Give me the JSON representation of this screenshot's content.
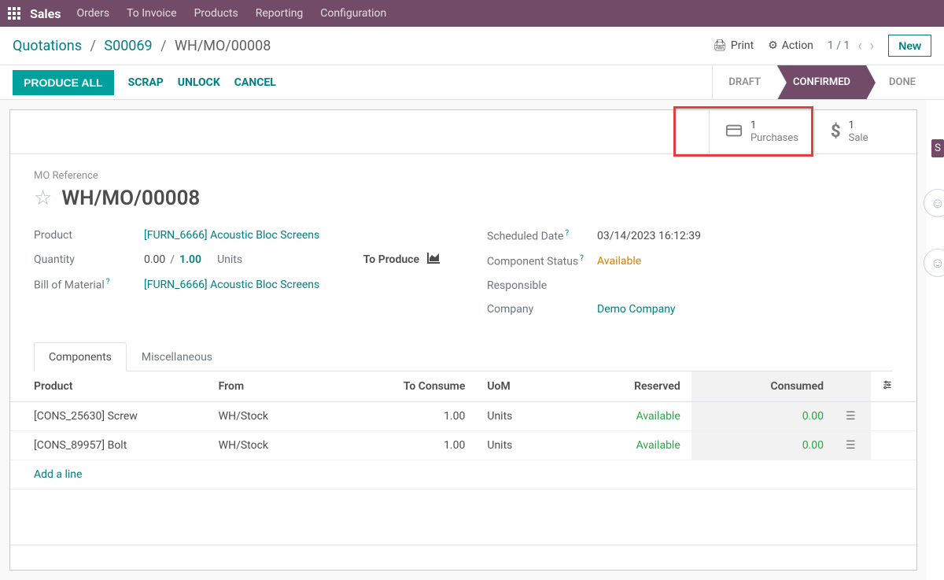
{
  "topnav": {
    "brand": "Sales",
    "items": [
      "Orders",
      "To Invoice",
      "Products",
      "Reporting",
      "Configuration"
    ]
  },
  "breadcrumb": {
    "root": "Quotations",
    "mid": "S00069",
    "current": "WH/MO/00008"
  },
  "bc_actions": {
    "print": "Print",
    "action": "Action",
    "pager": "1 / 1",
    "new": "New"
  },
  "action_bar": {
    "produce_all": "PRODUCE ALL",
    "scrap": "SCRAP",
    "unlock": "UNLOCK",
    "cancel": "CANCEL"
  },
  "status": {
    "draft": "DRAFT",
    "confirmed": "CONFIRMED",
    "done": "DONE"
  },
  "stat": {
    "purchases_count": "1",
    "purchases_label": "Purchases",
    "sale_count": "1",
    "sale_label": "Sale"
  },
  "form": {
    "ref_label": "MO Reference",
    "title": "WH/MO/00008",
    "left": {
      "product_label": "Product",
      "product_value": "[FURN_6666] Acoustic Bloc Screens",
      "qty_label": "Quantity",
      "qty_done": "0.00",
      "qty_sep": "/",
      "qty_total": "1.00",
      "qty_unit": "Units",
      "to_produce": "To Produce",
      "bom_label": "Bill of Material",
      "bom_value": "[FURN_6666] Acoustic Bloc Screens"
    },
    "right": {
      "sched_label": "Scheduled Date",
      "sched_value": "03/14/2023 16:12:39",
      "comp_status_label": "Component Status",
      "comp_status_value": "Available",
      "resp_label": "Responsible",
      "company_label": "Company",
      "company_value": "Demo Company"
    }
  },
  "tabs": {
    "components": "Components",
    "misc": "Miscellaneous"
  },
  "table": {
    "headers": {
      "product": "Product",
      "from": "From",
      "to_consume": "To Consume",
      "uom": "UoM",
      "reserved": "Reserved",
      "consumed": "Consumed"
    },
    "rows": [
      {
        "product": "[CONS_25630] Screw",
        "from": "WH/Stock",
        "to_consume": "1.00",
        "uom": "Units",
        "reserved": "Available",
        "consumed": "0.00"
      },
      {
        "product": "[CONS_89957] Bolt",
        "from": "WH/Stock",
        "to_consume": "1.00",
        "uom": "Units",
        "reserved": "Available",
        "consumed": "0.00"
      }
    ],
    "add_line": "Add a line"
  },
  "right_badge": "S"
}
